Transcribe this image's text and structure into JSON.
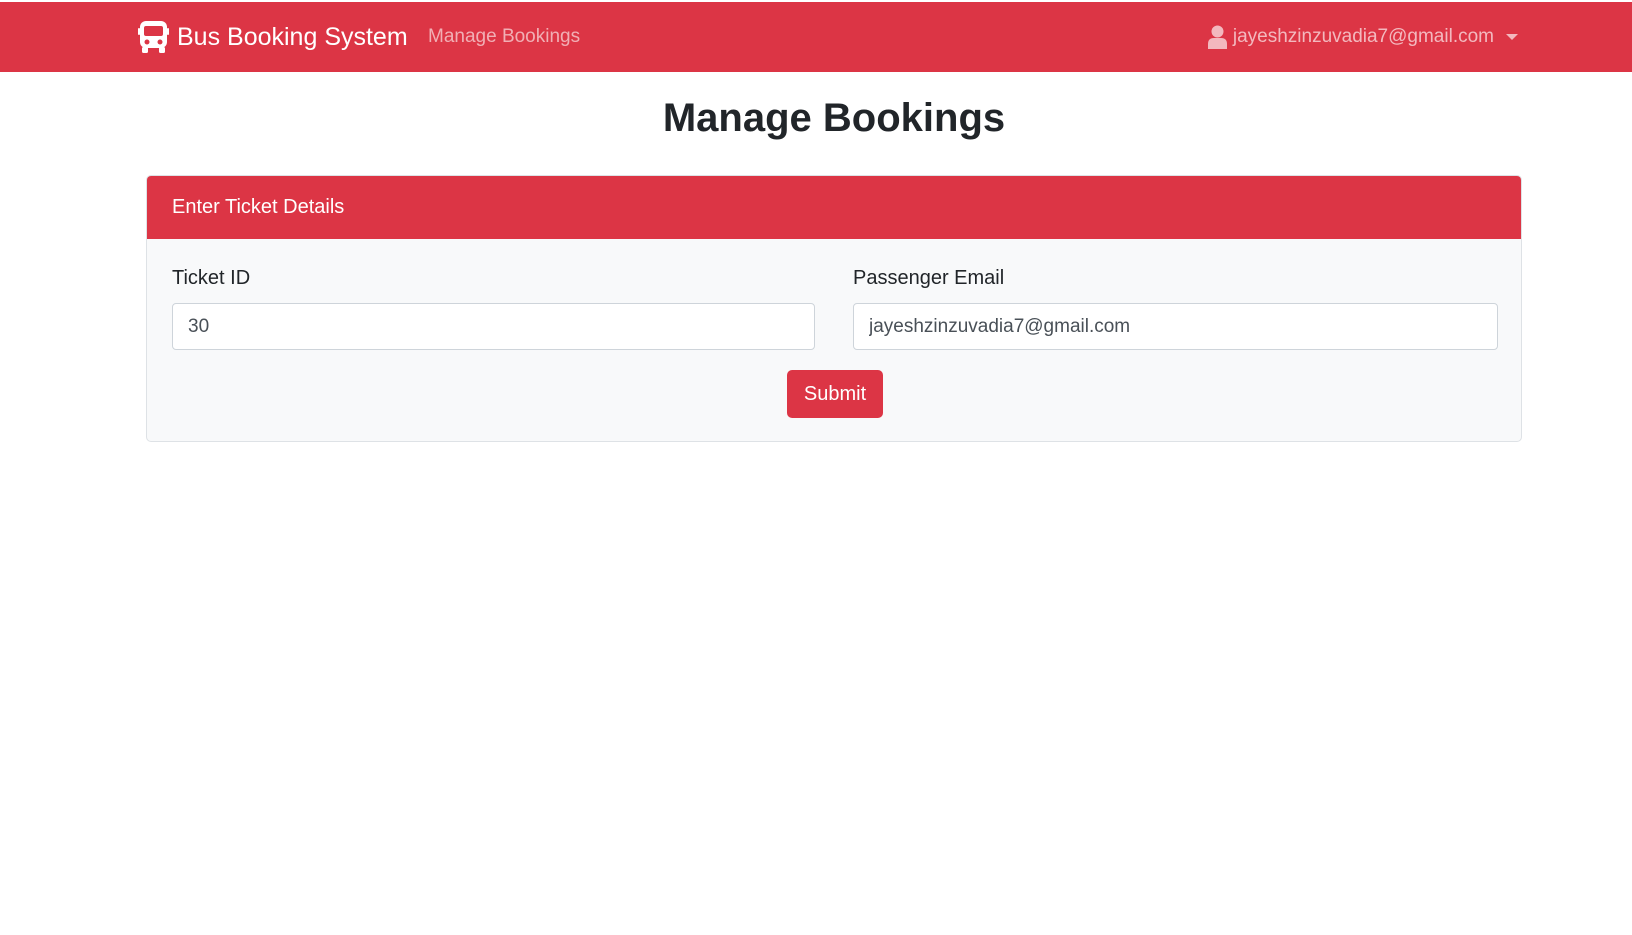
{
  "navbar": {
    "brand_icon": "bus-icon",
    "brand_label": "Bus Booking System",
    "nav_link": "Manage Bookings",
    "user_icon": "user-icon",
    "user_email": "jayeshzinzuvadia7@gmail.com",
    "background_color": "#dc3545"
  },
  "page": {
    "title": "Manage Bookings"
  },
  "card": {
    "header": "Enter Ticket Details",
    "ticket_id": {
      "label": "Ticket ID",
      "value": "30"
    },
    "passenger_email": {
      "label": "Passenger Email",
      "value": "jayeshzinzuvadia7@gmail.com"
    },
    "submit_label": "Submit"
  },
  "colors": {
    "accent": "#dc3545",
    "card_body": "#f8f9fa"
  }
}
